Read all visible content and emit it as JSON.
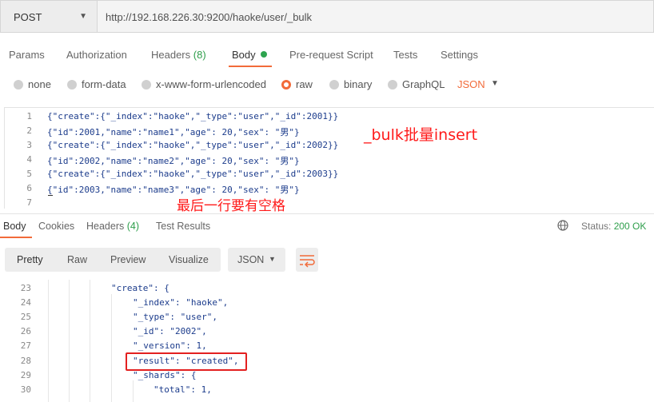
{
  "request": {
    "method": "POST",
    "url": "http://192.168.226.30:9200/haoke/user/_bulk"
  },
  "request_tabs": [
    {
      "label": "Params"
    },
    {
      "label": "Authorization"
    },
    {
      "label": "Headers",
      "count": "(8)"
    },
    {
      "label": "Body",
      "active": true
    },
    {
      "label": "Pre-request Script"
    },
    {
      "label": "Tests"
    },
    {
      "label": "Settings"
    }
  ],
  "body_types": [
    {
      "label": "none",
      "selected": false
    },
    {
      "label": "form-data",
      "selected": false
    },
    {
      "label": "x-www-form-urlencoded",
      "selected": false
    },
    {
      "label": "raw",
      "selected": true
    },
    {
      "label": "binary",
      "selected": false
    },
    {
      "label": "GraphQL",
      "selected": false
    }
  ],
  "raw_format": "JSON",
  "editor": {
    "lines": [
      {
        "n": "1",
        "text": "{\"create\":{\"_index\":\"haoke\",\"_type\":\"user\",\"_id\":2001}}"
      },
      {
        "n": "2",
        "text": "{\"id\":2001,\"name\":\"name1\",\"age\": 20,\"sex\": \"男\"}"
      },
      {
        "n": "3",
        "text": "{\"create\":{\"_index\":\"haoke\",\"_type\":\"user\",\"_id\":2002}}"
      },
      {
        "n": "4",
        "text": "{\"id\":2002,\"name\":\"name2\",\"age\": 20,\"sex\": \"男\"}"
      },
      {
        "n": "5",
        "text": "{\"create\":{\"_index\":\"haoke\",\"_type\":\"user\",\"_id\":2003}}"
      },
      {
        "n": "6",
        "text": "{\"id\":2003,\"name\":\"name3\",\"age\": 20,\"sex\": \"男\"}"
      },
      {
        "n": "7",
        "text": ""
      }
    ]
  },
  "annotations": {
    "bulk_note": "_bulk批量insert",
    "last_line_note": "最后一行要有空格"
  },
  "response_tabs": [
    {
      "label": "Body",
      "active": true
    },
    {
      "label": "Cookies"
    },
    {
      "label": "Headers",
      "count": "(4)"
    },
    {
      "label": "Test Results"
    }
  ],
  "status": {
    "label": "Status:",
    "value": "200 OK",
    "color": "#2e9e4b"
  },
  "view_modes": [
    "Pretty",
    "Raw",
    "Preview",
    "Visualize"
  ],
  "view_format": "JSON",
  "response_body": {
    "lines": [
      {
        "n": "23",
        "text": "\"create\": {"
      },
      {
        "n": "24",
        "text": "\"_index\": \"haoke\","
      },
      {
        "n": "25",
        "text": "\"_type\": \"user\","
      },
      {
        "n": "26",
        "text": "\"_id\": \"2002\","
      },
      {
        "n": "27",
        "text": "\"_version\": 1,"
      },
      {
        "n": "28",
        "text": "\"result\": \"created\","
      },
      {
        "n": "29",
        "text": "\"_shards\": {"
      },
      {
        "n": "30",
        "text": "\"total\": 1,"
      }
    ]
  },
  "colors": {
    "accent": "#f26b3a",
    "success": "#2e9e4b",
    "annotation": "#ff1a1a"
  }
}
